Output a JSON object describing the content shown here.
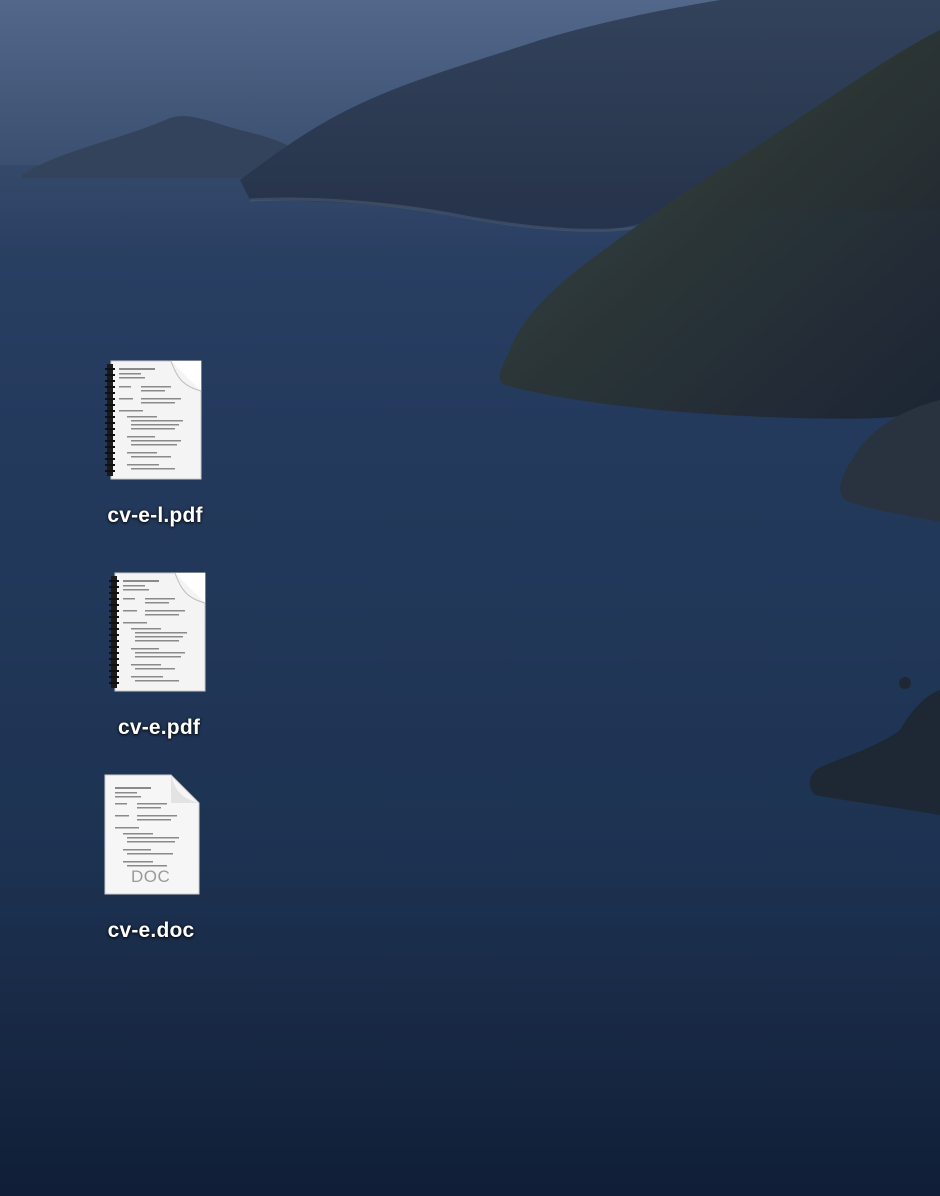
{
  "desktop": {
    "icons": [
      {
        "label": "cv-e-l.pdf",
        "icon": "pdf-document-icon"
      },
      {
        "label": "cv-e.pdf",
        "icon": "pdf-document-icon"
      },
      {
        "label": "cv-e.doc",
        "icon": "doc-document-icon",
        "badge": "DOC"
      }
    ]
  },
  "colors": {
    "sea": "#213757",
    "sky": "#4a5f80",
    "label": "#ffffff"
  }
}
